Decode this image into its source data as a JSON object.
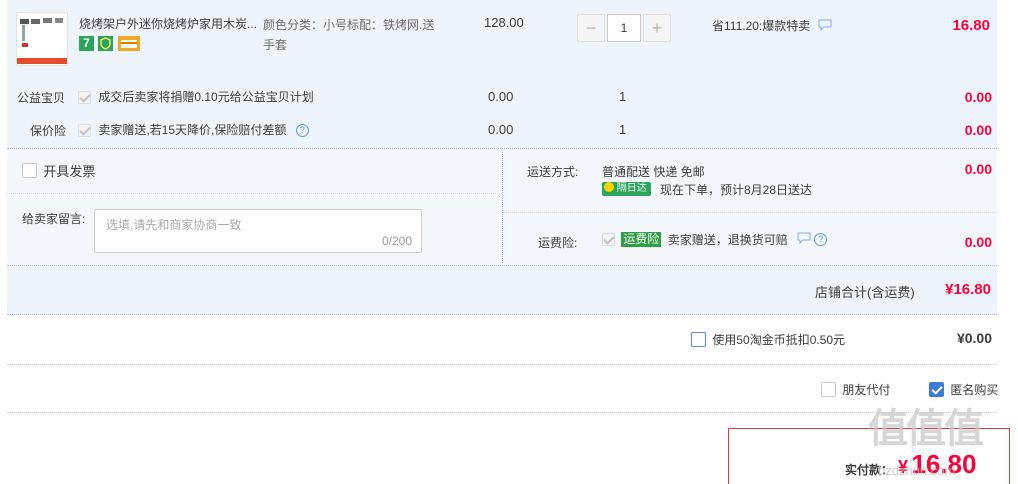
{
  "item": {
    "title": "烧烤架户外迷你烧烤炉家用木炭...",
    "sku_label": "颜色分类：小号标配：铁烤网.送",
    "sku_label2": "手套",
    "price": "128.00",
    "qty": "1",
    "promo": "省111.20:爆款特卖",
    "subtotal": "16.80",
    "badge_seven": "7",
    "minus": "−",
    "plus": "+"
  },
  "charity": {
    "label": "公益宝贝",
    "desc": "成交后卖家将捐赠0.10元给公益宝贝计划",
    "price": "0.00",
    "qty": "1",
    "total": "0.00"
  },
  "insure": {
    "label": "保价险",
    "desc": "卖家赠送,若15天降价,保险赔付差额",
    "price": "0.00",
    "qty": "1",
    "total": "0.00"
  },
  "invoice": {
    "label": "开具发票"
  },
  "message": {
    "label": "给卖家留言:",
    "placeholder": "选填,请先和商家协商一致",
    "counter": "0/200"
  },
  "shipping": {
    "label": "运送方式:",
    "method": "普通配送 快递 免邮",
    "badge": "隔日达",
    "eta": "现在下单，预计8月28日送达",
    "cost": "0.00"
  },
  "freight_ins": {
    "label": "运费险:",
    "tag": "运费险",
    "desc": "卖家赠送，退换货可赔",
    "cost": "0.00"
  },
  "shop_total": {
    "label": "店铺合计(含运费)",
    "value": "¥16.80"
  },
  "coins": {
    "label": "使用50淘金币抵扣0.50元",
    "value": "¥0.00"
  },
  "options": {
    "friend_pay": "朋友代付",
    "anonymous": "匿名购买"
  },
  "pay": {
    "label": "实付款：",
    "currency": "¥",
    "value": "16.80"
  },
  "watermark": {
    "text": "值值值",
    "site": "hzdzhun.com"
  },
  "colors": {
    "accent_blue": "#3a7bd5",
    "price_red": "#ff0036",
    "panel_bg": "#eef4fb",
    "tag_green": "#2e9e44"
  }
}
